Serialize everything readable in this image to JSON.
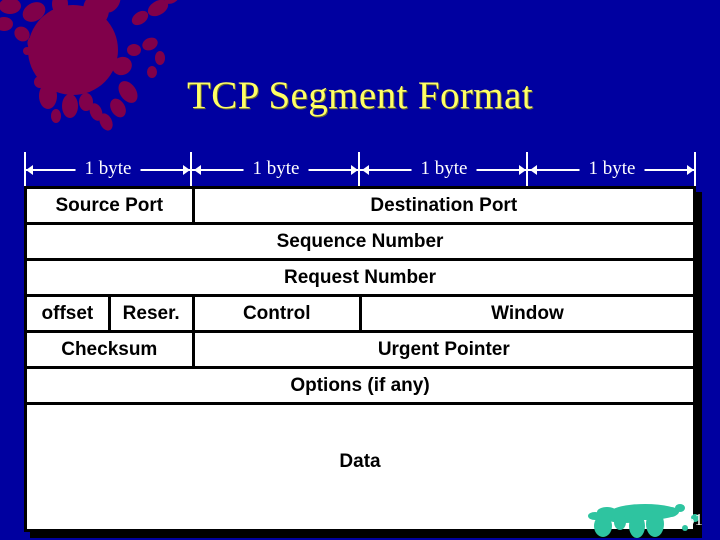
{
  "slide": {
    "title": "TCP Segment Format",
    "page_number": "51",
    "background_color": "#0000a0",
    "title_color": "#ffff66",
    "splatter_top_left_color": "#80004a",
    "splatter_bottom_right_color": "#2ec4a0"
  },
  "ruler": {
    "segments": [
      {
        "label": "1 byte"
      },
      {
        "label": "1 byte"
      },
      {
        "label": "1 byte"
      },
      {
        "label": "1 byte"
      }
    ]
  },
  "table": {
    "rows": [
      {
        "name": "ports",
        "cells": [
          {
            "label": "Source Port",
            "span": 2
          },
          {
            "label": "Destination Port",
            "span": 2
          }
        ]
      },
      {
        "name": "sequence",
        "cells": [
          {
            "label": "Sequence Number",
            "span": 4
          }
        ]
      },
      {
        "name": "request",
        "cells": [
          {
            "label": "Request Number",
            "span": 4
          }
        ]
      },
      {
        "name": "offset-reser-control-window",
        "cells": [
          {
            "label": "offset",
            "span": 1
          },
          {
            "label": "Reser.",
            "span": 1
          },
          {
            "label": "Control",
            "span": 1
          },
          {
            "label": "Window",
            "span": 1
          }
        ]
      },
      {
        "name": "checksum-urgent",
        "cells": [
          {
            "label": "Checksum",
            "span": 2
          },
          {
            "label": "Urgent Pointer",
            "span": 2
          }
        ]
      },
      {
        "name": "options",
        "cells": [
          {
            "label": "Options (if any)",
            "span": 4
          }
        ]
      },
      {
        "name": "data",
        "cells": [
          {
            "label": "Data",
            "span": 4
          }
        ]
      }
    ]
  }
}
